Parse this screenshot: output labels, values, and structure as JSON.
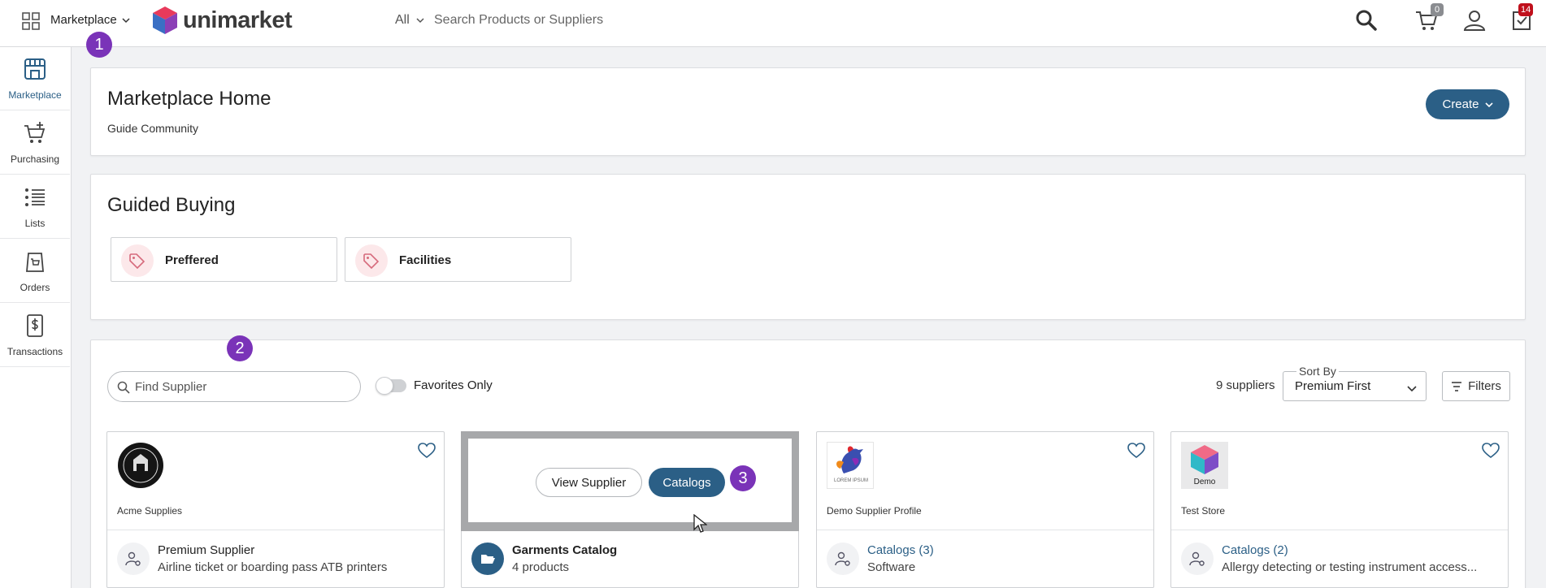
{
  "topbar": {
    "marketplace_label": "Marketplace",
    "logo_text": "unimarket",
    "search_scope": "All",
    "search_placeholder": "Search Products or Suppliers",
    "cart_count": "0",
    "tasks_count": "14"
  },
  "steps": {
    "one": "1",
    "two": "2",
    "three": "3"
  },
  "sidebar": {
    "items": [
      {
        "label": "Marketplace"
      },
      {
        "label": "Purchasing"
      },
      {
        "label": "Lists"
      },
      {
        "label": "Orders"
      },
      {
        "label": "Transactions"
      }
    ]
  },
  "home": {
    "title": "Marketplace Home",
    "subtitle": "Guide Community",
    "create_label": "Create"
  },
  "guided": {
    "title": "Guided Buying",
    "tiles": [
      {
        "label": "Preffered"
      },
      {
        "label": "Facilities"
      }
    ]
  },
  "suppliers": {
    "find_placeholder": "Find Supplier",
    "favorites_label": "Favorites Only",
    "count_text": "9 suppliers",
    "sort_legend": "Sort By",
    "sort_value": "Premium First",
    "filters_label": "Filters",
    "cards": [
      {
        "name": "Acme Supplies",
        "line1": "Premium Supplier",
        "line2": "Airline ticket or boarding pass ATB printers"
      },
      {
        "name": "",
        "line1": "Garments Catalog",
        "line2": "4 products",
        "view_supplier": "View Supplier",
        "catalogs": "Catalogs"
      },
      {
        "name": "Demo Supplier Profile",
        "line1": "Catalogs (3)",
        "line2": "Software",
        "logo_caption": "LOREM IPSUM"
      },
      {
        "name": "Test Store",
        "line1": "Catalogs (2)",
        "line2": "Allergy detecting or testing instrument access...",
        "logo_caption": "Demo"
      }
    ]
  },
  "colors": {
    "primary": "#2b5f86",
    "step": "#7a33b8",
    "badge": "#c0101c"
  }
}
